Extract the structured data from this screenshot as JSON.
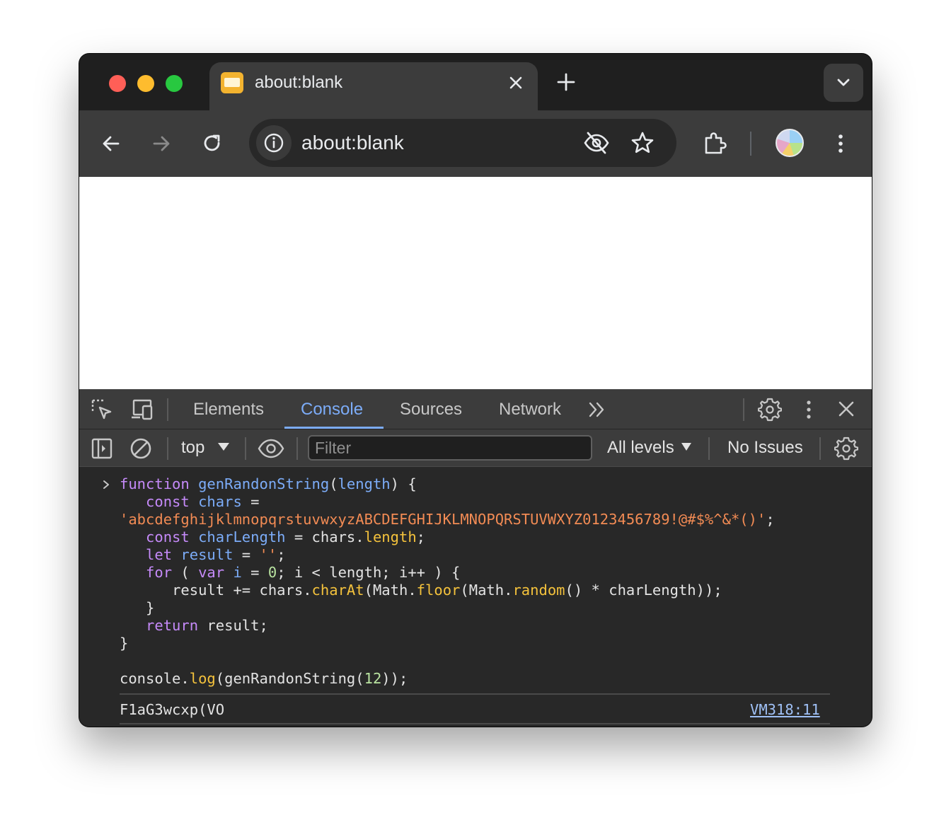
{
  "window": {
    "traffic_lights": {
      "close": "#ff5f57",
      "minimize": "#febc2e",
      "zoom": "#28c840"
    }
  },
  "tab": {
    "title": "about:blank",
    "favicon_color": "#f3b32f"
  },
  "toolbar": {
    "url": "about:blank"
  },
  "devtools": {
    "tabs": [
      {
        "label": "Elements",
        "active": false
      },
      {
        "label": "Console",
        "active": true
      },
      {
        "label": "Sources",
        "active": false
      },
      {
        "label": "Network",
        "active": false
      }
    ],
    "accent_color": "#7cacf8",
    "console_bar": {
      "context": "top",
      "filter_placeholder": "Filter",
      "levels": "All levels",
      "issues": "No Issues"
    }
  },
  "console": {
    "code": {
      "l1": {
        "kw": "function",
        "name": "genRandonString",
        "open": "(",
        "param": "length",
        "close": ") {"
      },
      "l2": {
        "kw": "const",
        "name": "chars",
        "rest": " ="
      },
      "l3": {
        "str": "'abcdefghijklmnopqrstuvwxyzABCDEFGHIJKLMNOPQRSTUVWXYZ0123456789!@#$%^&*()'",
        "end": ";"
      },
      "l4": {
        "kw": "const",
        "name": "charLength",
        "mid": " = chars.",
        "prop": "length",
        "end": ";"
      },
      "l5": {
        "kw": "let",
        "name": "result",
        "mid": " = ",
        "str": "''",
        "end": ";"
      },
      "l6": {
        "kw1": "for",
        "mid1": " ( ",
        "kw2": "var",
        "name": "i",
        "mid2": " = ",
        "num": "0",
        "rest": "; i < length; i++ ) {"
      },
      "l7": {
        "a": "result += chars.",
        "m1": "charAt",
        "b": "(Math.",
        "m2": "floor",
        "c": "(Math.",
        "m3": "random",
        "d": "() * charLength));"
      },
      "l8": "}",
      "l9": {
        "kw": "return",
        "rest": " result;"
      },
      "l10": "}",
      "l12": {
        "a": "console.",
        "m": "log",
        "b": "(genRandonString(",
        "num": "12",
        "c": "));"
      }
    },
    "output": "F1aG3wcxp(VO",
    "source_link": "VM318:11"
  }
}
